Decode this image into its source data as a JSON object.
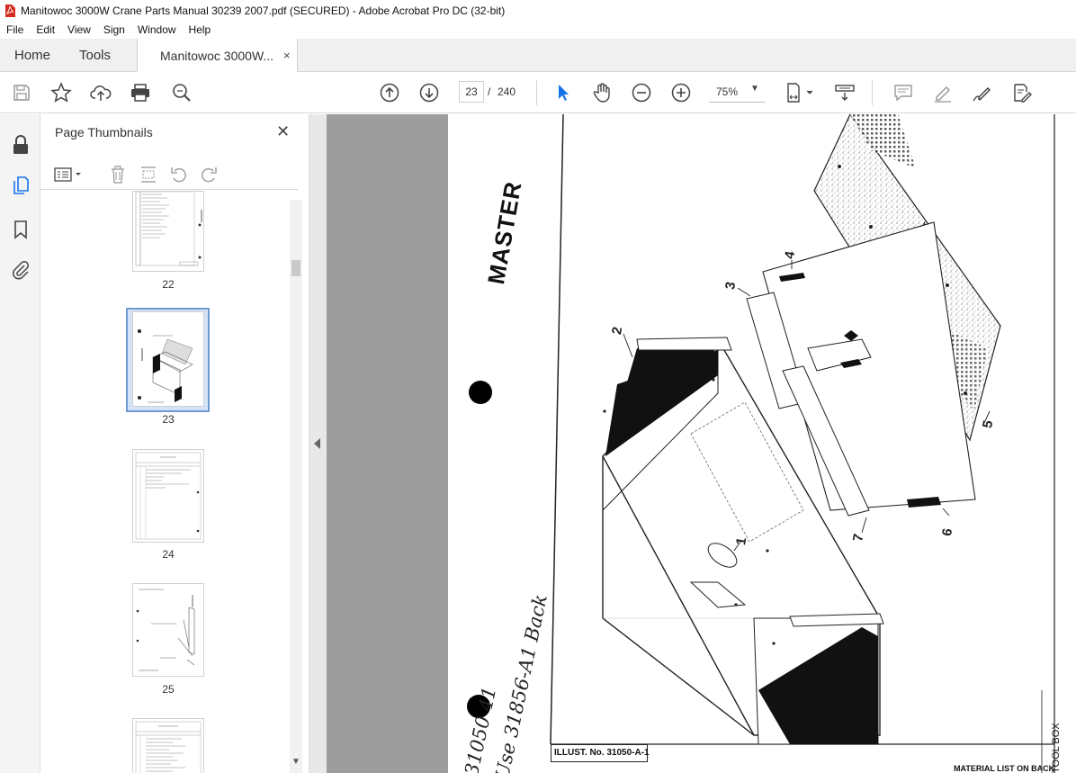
{
  "window": {
    "title": "Manitowoc 3000W Crane Parts Manual 30239 2007.pdf (SECURED) - Adobe Acrobat Pro DC (32-bit)"
  },
  "menu": [
    "File",
    "Edit",
    "View",
    "Sign",
    "Window",
    "Help"
  ],
  "tabs": {
    "home": "Home",
    "tools": "Tools",
    "document": "Manitowoc 3000W...",
    "close": "×"
  },
  "toolbar": {
    "current_page": "23",
    "separator": "/",
    "total_pages": "240",
    "zoom": "75%"
  },
  "thumbnails": {
    "title": "Page Thumbnails",
    "close": "✕",
    "pages": [
      "22",
      "23",
      "24",
      "25"
    ],
    "selected": "23"
  },
  "drawing": {
    "master_stamp": "MASTER",
    "handwritten_top": "31050 41",
    "handwritten_bottom": "Use 31856-A1 Back",
    "illust_label": "ILLUST. No. 31050-A-1",
    "material_list": "MATERIAL LIST ON BACK",
    "side_label": "TOOL BOX",
    "callouts": [
      "1",
      "2",
      "3",
      "4",
      "5",
      "6",
      "7"
    ]
  },
  "colors": {
    "selection": "#d4e3f5",
    "selection_border": "#6f9bd1",
    "viewer_bg": "#9d9d9d",
    "select_tool": "#1473e6",
    "acrobat_red": "#d62c1f"
  }
}
